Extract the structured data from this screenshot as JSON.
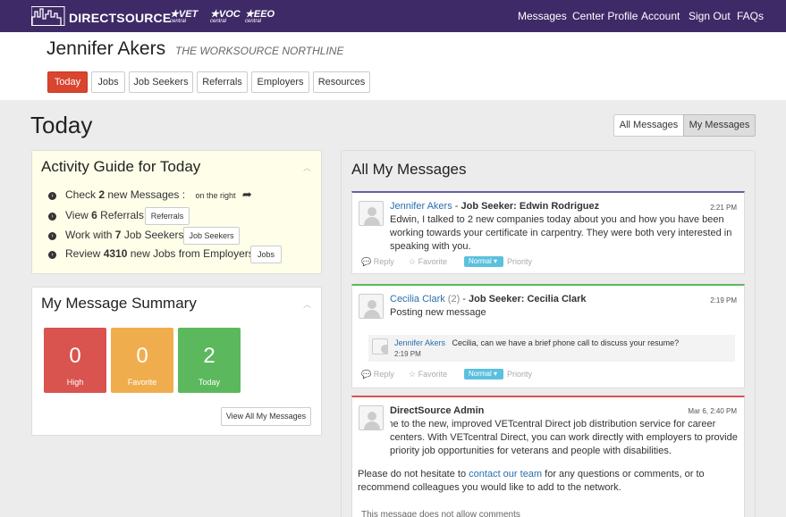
{
  "app": {
    "brand": "DIRECTSOURCE"
  },
  "partners": [
    {
      "name": "VET",
      "sub": "central"
    },
    {
      "name": "VOC",
      "sub": "central"
    },
    {
      "name": "EEO",
      "sub": "central"
    }
  ],
  "nav": {
    "messages": "Messages",
    "center_profile": "Center Profile",
    "account": "Account",
    "sign_out": "Sign Out",
    "faqs": "FAQs"
  },
  "user": {
    "name": "Jennifer Akers",
    "org": "THE WORKSOURCE NORTHLINE"
  },
  "tabs": [
    "Today",
    "Jobs",
    "Job Seekers",
    "Referrals",
    "Employers",
    "Resources"
  ],
  "page": {
    "title": "Today",
    "all_messages": "All Messages",
    "my_messages": "My Messages"
  },
  "activity": {
    "title": "Activity Guide for Today",
    "row1": {
      "pre": "Check ",
      "count": "2",
      "post": " new Messages :",
      "hint": "on the right"
    },
    "row2": {
      "pre": "View ",
      "count": "6",
      "post": " Referrals:",
      "button": "Referrals"
    },
    "row3": {
      "pre": "Work with ",
      "count": "7",
      "post": " Job Seekers:",
      "button": "Job Seekers"
    },
    "row4": {
      "pre": "Review ",
      "count": "4310",
      "post": " new Jobs from Employers:",
      "button": "Jobs"
    }
  },
  "summary": {
    "title": "My Message Summary",
    "tiles": [
      {
        "value": "0",
        "label": "High",
        "color": "#d9534f"
      },
      {
        "value": "0",
        "label": "Favorite",
        "color": "#f0ad4e"
      },
      {
        "value": "2",
        "label": "Today",
        "color": "#5cb85c"
      }
    ],
    "view_all": "View All My Messages"
  },
  "messages_panel": {
    "title": "All My Messages"
  },
  "actions": {
    "reply": "Reply",
    "favorite": "Favorite",
    "priority_value": "Normal",
    "priority": "Priority"
  },
  "messages": [
    {
      "sender": "Jennifer Akers",
      "sep": " - ",
      "subject": "Job Seeker: Edwin Rodriguez",
      "time": "2:21 PM",
      "body": "Edwin, I talked to 2 new companies today about you and how you have been working towards your certificate in carpentry. They were both very interested in speaking with you.",
      "accent": "#6a5fa8"
    },
    {
      "sender": "Cecilia Clark",
      "count": " (2)",
      "sep": " - ",
      "subject": "Job Seeker: Cecilia Clark",
      "time": "2:19 PM",
      "body": "Posting new message",
      "accent": "#5cb85c",
      "reply": {
        "sender": "Jennifer Akers",
        "text": "Cecilia, can we have a brief phone call to discuss your resume?",
        "time": "2:19 PM"
      }
    },
    {
      "sender": "DirectSource Admin",
      "time": "Mar 6, 2:40 PM",
      "body1": "Welcome to the new, improved VETcentral Direct job distribution service for career centers. With VETcentral Direct, you can work directly with employers to provide priority job opportunities for veterans and people with disabilities.",
      "body2_pre": "Please do not hesitate to ",
      "body2_link": "contact our team",
      "body2_post": " for any questions or comments, or to recommend colleagues you would like to add to the network.",
      "footer": "This message does not allow comments",
      "accent": "#d9534f"
    }
  ]
}
